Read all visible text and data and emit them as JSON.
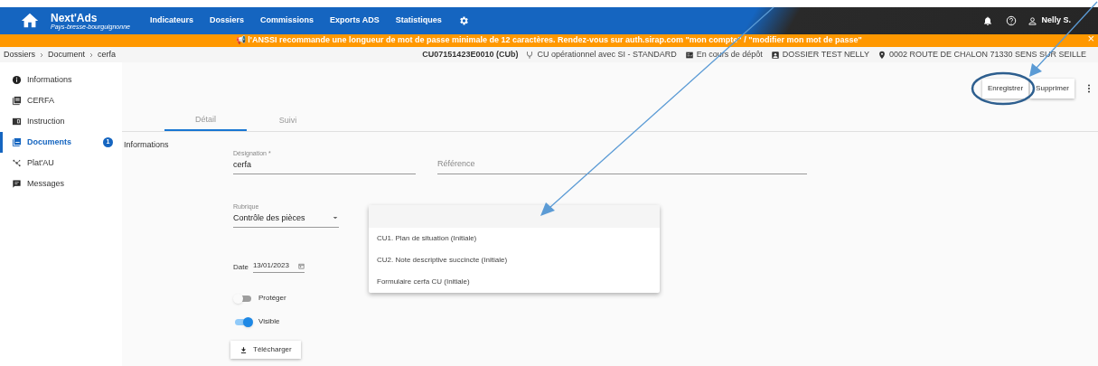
{
  "app": {
    "name": "Next'Ads",
    "subtitle": "Pays-bresse-bourguignonne"
  },
  "nav": [
    "Indicateurs",
    "Dossiers",
    "Commissions",
    "Exports ADS",
    "Statistiques"
  ],
  "user": {
    "name": "Nelly S."
  },
  "banner": {
    "icon": "📢",
    "text": "l'ANSSI recommande une longueur de mot de passe minimale de 12 caractères. Rendez-vous sur auth.sirap.com \"mon compte\" / \"modifier mon mot de passe\"",
    "close": "×"
  },
  "breadcrumb": [
    "Dossiers",
    "Document",
    "cerfa"
  ],
  "dossier": {
    "number": "CU07151423E0010 (CUb)",
    "details": [
      {
        "kind": "type",
        "text": "CU opérationnel avec SI - STANDARD"
      },
      {
        "kind": "status",
        "text": "En cours de dépôt"
      },
      {
        "kind": "person",
        "text": "DOSSIER TEST NELLY"
      },
      {
        "kind": "address",
        "text": "0002 ROUTE DE CHALON 71330 SENS SUR SEILLE"
      }
    ]
  },
  "sidebar": {
    "items": [
      {
        "kind": "info",
        "label": "Informations",
        "selected": false
      },
      {
        "kind": "cerfa",
        "label": "CERFA",
        "selected": false
      },
      {
        "kind": "instruction",
        "label": "Instruction",
        "selected": false
      },
      {
        "kind": "documents",
        "label": "Documents",
        "selected": true,
        "badge": "1"
      },
      {
        "kind": "plataus",
        "label": "Plat'AU",
        "selected": false
      },
      {
        "kind": "messages",
        "label": "Messages",
        "selected": false
      }
    ]
  },
  "actions": [
    "Enregistrer",
    "Supprimer"
  ],
  "tabs": [
    {
      "label": "Détail",
      "selected": true
    },
    {
      "label": "Suivi",
      "selected": false
    }
  ],
  "section": "Informations",
  "form": {
    "designation": {
      "label": "Désignation *",
      "value": "cerfa"
    },
    "reference": {
      "placeholder": "Référence"
    },
    "rubrique": {
      "label": "Rubrique",
      "value": "Contrôle des pièces"
    },
    "date": {
      "label": "Date",
      "value": "13/01/2023"
    },
    "toggles": [
      {
        "label": "Protéger",
        "on": false
      },
      {
        "label": "Visible",
        "on": true
      }
    ],
    "download": "Télécharger"
  },
  "dropdown": {
    "options": [
      "CU1. Plan de situation (Initiale)",
      "CU2. Note descriptive succincte (Initiale)",
      "Formulaire cerfa CU (Initiale)"
    ]
  }
}
